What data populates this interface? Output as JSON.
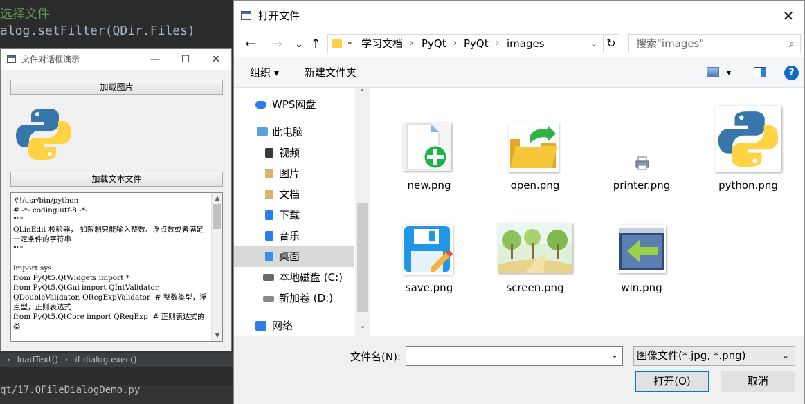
{
  "ide": {
    "line1": "选择文件",
    "line2": "alog.setFilter(QDir.Files)",
    "breadcrumb": [
      "loadText()",
      "if dialog.exec()"
    ],
    "crumb_sep": "›",
    "path": "qt/17.QFileDialogDemo.py"
  },
  "demo": {
    "title": "文件对话框演示",
    "minimize": "—",
    "maximize": "☐",
    "close": "✕",
    "load_image_button": "加载图片",
    "load_text_button": "加载文本文件",
    "text_content": "#!/usr/bin/python\n# -*- coding:utf-8 -*-\n\"\"\"\nQLinEdit 校验器， 如限制只能输入整数、浮点数或者满足一定条件的字符串\n\"\"\"\n\nimport sys\nfrom PyQt5.QtWidgets import *\nfrom PyQt5.QtGui import QIntValidator,\nQDoubleValidator, QRegExpValidator  # 整数类型，浮点型，正则表达式\nfrom PyQt5.QtCore import QRegExp  # 正则表达式的类\n\n\n"
  },
  "dialog": {
    "title": "打开文件",
    "close": "✕",
    "nav": {
      "back": "←",
      "forward": "→",
      "recent": "⌄",
      "up": "↑",
      "refresh": "↻",
      "dropdown": "⌄"
    },
    "address": {
      "prefix": "«",
      "segments": [
        "学习文档",
        "PyQt",
        "PyQt",
        "images"
      ],
      "separator": "›"
    },
    "search_placeholder": "搜索\"images\"",
    "search_icon": "⌕",
    "toolbar": {
      "organize": "组织 ▾",
      "new_folder": "新建文件夹",
      "view_dropdown": "▾",
      "help": "?"
    },
    "sidebar": [
      {
        "label": "WPS网盘",
        "icon": "cloud-icon",
        "color": "#2b7de9"
      },
      {
        "label": "此电脑",
        "icon": "computer-icon",
        "color": "#5ca0e0"
      },
      {
        "label": "视频",
        "icon": "video-folder-icon",
        "color": "#3a3a3a"
      },
      {
        "label": "图片",
        "icon": "pictures-folder-icon",
        "color": "#d8b36a"
      },
      {
        "label": "文档",
        "icon": "documents-folder-icon",
        "color": "#d8b36a"
      },
      {
        "label": "下载",
        "icon": "downloads-folder-icon",
        "color": "#2b7de9"
      },
      {
        "label": "音乐",
        "icon": "music-folder-icon",
        "color": "#2b7de9"
      },
      {
        "label": "桌面",
        "icon": "desktop-folder-icon",
        "color": "#3a8ee6"
      },
      {
        "label": "本地磁盘 (C:)",
        "icon": "drive-c-icon",
        "color": "#6a6a6a"
      },
      {
        "label": "新加卷 (D:)",
        "icon": "drive-d-icon",
        "color": "#8a8a8a"
      },
      {
        "label": "网络",
        "icon": "network-icon",
        "color": "#2b7de9"
      }
    ],
    "sidebar_scroll": {
      "up": "⌃",
      "down": "⌄"
    },
    "files": [
      {
        "name": "new.png",
        "icon": "new-file-icon"
      },
      {
        "name": "open.png",
        "icon": "open-folder-icon"
      },
      {
        "name": "printer.png",
        "icon": "printer-icon"
      },
      {
        "name": "python.png",
        "icon": "python-logo-icon"
      },
      {
        "name": "save.png",
        "icon": "save-disk-icon"
      },
      {
        "name": "screen.png",
        "icon": "landscape-icon"
      },
      {
        "name": "win.png",
        "icon": "window-arrow-icon"
      }
    ],
    "filename_label": "文件名(N):",
    "filename_value": "",
    "filter_value": "图像文件(*.jpg, *.png)",
    "open_button": "打开(O)",
    "cancel_button": "取消",
    "accent_color": "#0078d7"
  }
}
